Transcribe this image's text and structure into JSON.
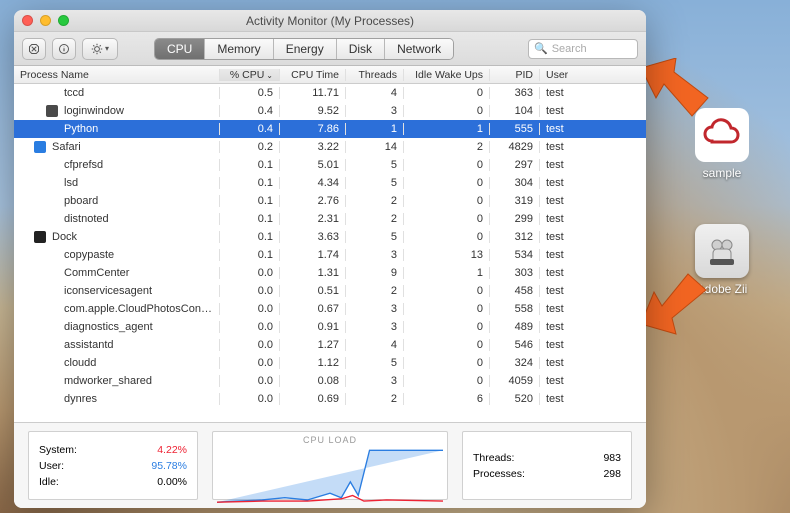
{
  "window": {
    "title": "Activity Monitor (My Processes)",
    "tabs": [
      "CPU",
      "Memory",
      "Energy",
      "Disk",
      "Network"
    ],
    "active_tab": "CPU",
    "search_placeholder": "Search"
  },
  "columns": {
    "name": "Process Name",
    "cpu": "% CPU",
    "time": "CPU Time",
    "threads": "Threads",
    "idle": "Idle Wake Ups",
    "pid": "PID",
    "user": "User"
  },
  "processes": [
    {
      "name": "tccd",
      "cpu": "0.5",
      "time": "11.71",
      "threads": "4",
      "idle": "0",
      "pid": "363",
      "user": "test",
      "lvl": 1
    },
    {
      "name": "loginwindow",
      "cpu": "0.4",
      "time": "9.52",
      "threads": "3",
      "idle": "0",
      "pid": "104",
      "user": "test",
      "lvl": 1,
      "icon": "#4a4a4a"
    },
    {
      "name": "Python",
      "cpu": "0.4",
      "time": "7.86",
      "threads": "1",
      "idle": "1",
      "pid": "555",
      "user": "test",
      "lvl": 1,
      "selected": true
    },
    {
      "name": "Safari",
      "cpu": "0.2",
      "time": "3.22",
      "threads": "14",
      "idle": "2",
      "pid": "4829",
      "user": "test",
      "lvl": 0,
      "icon": "#2a7de1"
    },
    {
      "name": "cfprefsd",
      "cpu": "0.1",
      "time": "5.01",
      "threads": "5",
      "idle": "0",
      "pid": "297",
      "user": "test",
      "lvl": 1
    },
    {
      "name": "lsd",
      "cpu": "0.1",
      "time": "4.34",
      "threads": "5",
      "idle": "0",
      "pid": "304",
      "user": "test",
      "lvl": 1
    },
    {
      "name": "pboard",
      "cpu": "0.1",
      "time": "2.76",
      "threads": "2",
      "idle": "0",
      "pid": "319",
      "user": "test",
      "lvl": 1
    },
    {
      "name": "distnoted",
      "cpu": "0.1",
      "time": "2.31",
      "threads": "2",
      "idle": "0",
      "pid": "299",
      "user": "test",
      "lvl": 1
    },
    {
      "name": "Dock",
      "cpu": "0.1",
      "time": "3.63",
      "threads": "5",
      "idle": "0",
      "pid": "312",
      "user": "test",
      "lvl": 0,
      "icon": "#222"
    },
    {
      "name": "copypaste",
      "cpu": "0.1",
      "time": "1.74",
      "threads": "3",
      "idle": "13",
      "pid": "534",
      "user": "test",
      "lvl": 1
    },
    {
      "name": "CommCenter",
      "cpu": "0.0",
      "time": "1.31",
      "threads": "9",
      "idle": "1",
      "pid": "303",
      "user": "test",
      "lvl": 1
    },
    {
      "name": "iconservicesagent",
      "cpu": "0.0",
      "time": "0.51",
      "threads": "2",
      "idle": "0",
      "pid": "458",
      "user": "test",
      "lvl": 1
    },
    {
      "name": "com.apple.CloudPhotosConfi...",
      "cpu": "0.0",
      "time": "0.67",
      "threads": "3",
      "idle": "0",
      "pid": "558",
      "user": "test",
      "lvl": 1
    },
    {
      "name": "diagnostics_agent",
      "cpu": "0.0",
      "time": "0.91",
      "threads": "3",
      "idle": "0",
      "pid": "489",
      "user": "test",
      "lvl": 1
    },
    {
      "name": "assistantd",
      "cpu": "0.0",
      "time": "1.27",
      "threads": "4",
      "idle": "0",
      "pid": "546",
      "user": "test",
      "lvl": 1
    },
    {
      "name": "cloudd",
      "cpu": "0.0",
      "time": "1.12",
      "threads": "5",
      "idle": "0",
      "pid": "324",
      "user": "test",
      "lvl": 1
    },
    {
      "name": "mdworker_shared",
      "cpu": "0.0",
      "time": "0.08",
      "threads": "3",
      "idle": "0",
      "pid": "4059",
      "user": "test",
      "lvl": 1
    },
    {
      "name": "dynres",
      "cpu": "0.0",
      "time": "0.69",
      "threads": "2",
      "idle": "6",
      "pid": "520",
      "user": "test",
      "lvl": 1
    }
  ],
  "stats_left": {
    "system_label": "System:",
    "system": "4.22%",
    "user_label": "User:",
    "user": "95.78%",
    "idle_label": "Idle:",
    "idle": "0.00%"
  },
  "cpu_load_label": "CPU LOAD",
  "stats_right": {
    "threads_label": "Threads:",
    "threads": "983",
    "processes_label": "Processes:",
    "processes": "298"
  },
  "desktop": {
    "icon1_label": "sample",
    "icon2_label": "Adobe Zii"
  }
}
